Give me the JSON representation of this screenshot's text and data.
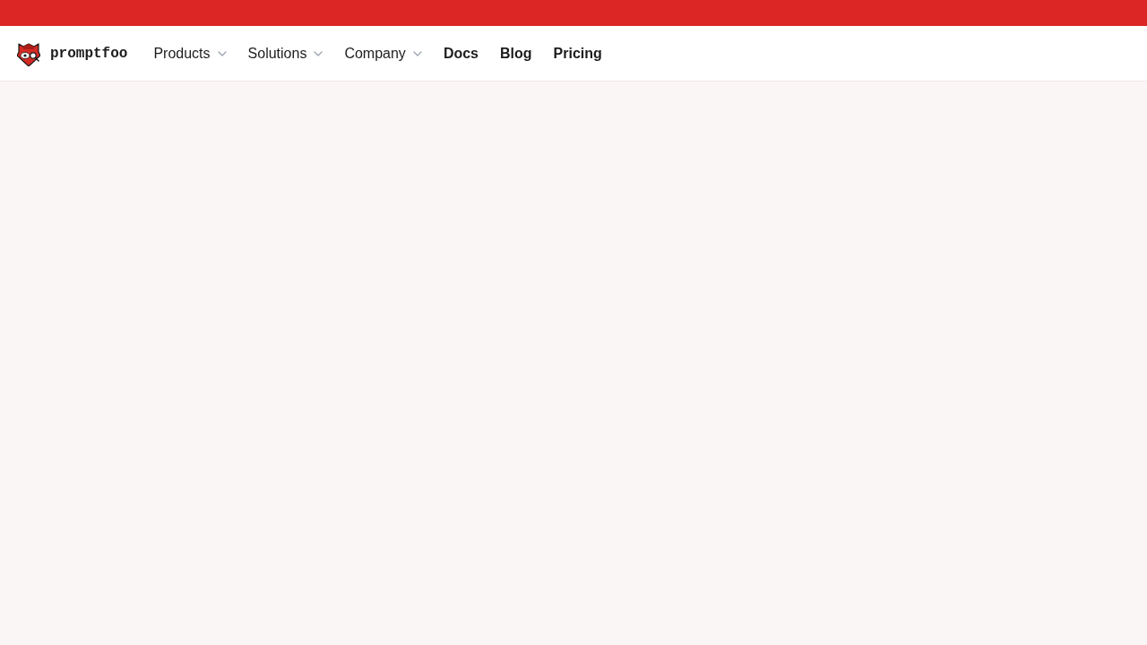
{
  "brand": {
    "name": "promptfoo"
  },
  "nav": {
    "items": [
      {
        "label": "Products",
        "kind": "dropdown"
      },
      {
        "label": "Solutions",
        "kind": "dropdown"
      },
      {
        "label": "Company",
        "kind": "dropdown"
      },
      {
        "label": "Docs",
        "kind": "link"
      },
      {
        "label": "Blog",
        "kind": "link"
      },
      {
        "label": "Pricing",
        "kind": "link"
      }
    ]
  }
}
